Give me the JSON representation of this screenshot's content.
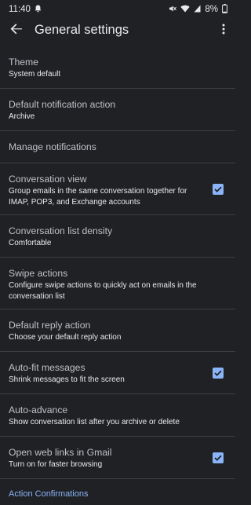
{
  "status_bar": {
    "time": "11:40",
    "battery": "8%",
    "icons": [
      "notification-bell-icon",
      "mute-icon",
      "wifi-icon",
      "signal-icon",
      "battery-icon"
    ]
  },
  "app_bar": {
    "title": "General settings",
    "back_icon": "arrow-back-icon",
    "more_icon": "more-vert-icon"
  },
  "settings": [
    {
      "title": "Theme",
      "subtitle": "System default"
    },
    {
      "title": "Default notification action",
      "subtitle": "Archive"
    },
    {
      "title": "Manage notifications",
      "subtitle": ""
    },
    {
      "title": "Conversation view",
      "subtitle": "Group emails in the same conversation together for IMAP, POP3, and Exchange accounts",
      "checked": true
    },
    {
      "title": "Conversation list density",
      "subtitle": "Comfortable"
    },
    {
      "title": "Swipe actions",
      "subtitle": "Configure swipe actions to quickly act on emails in the conversation list"
    },
    {
      "title": "Default reply action",
      "subtitle": "Choose your default reply action"
    },
    {
      "title": "Auto-fit messages",
      "subtitle": "Shrink messages to fit the screen",
      "checked": true
    },
    {
      "title": "Auto-advance",
      "subtitle": "Show conversation list after you archive or delete"
    },
    {
      "title": "Open web links in Gmail",
      "subtitle": "Turn on for faster browsing",
      "checked": true
    }
  ],
  "section_header": "Action Confirmations",
  "colors": {
    "background": "#202124",
    "accent": "#8ab4f8",
    "divider": "#3c4043"
  }
}
